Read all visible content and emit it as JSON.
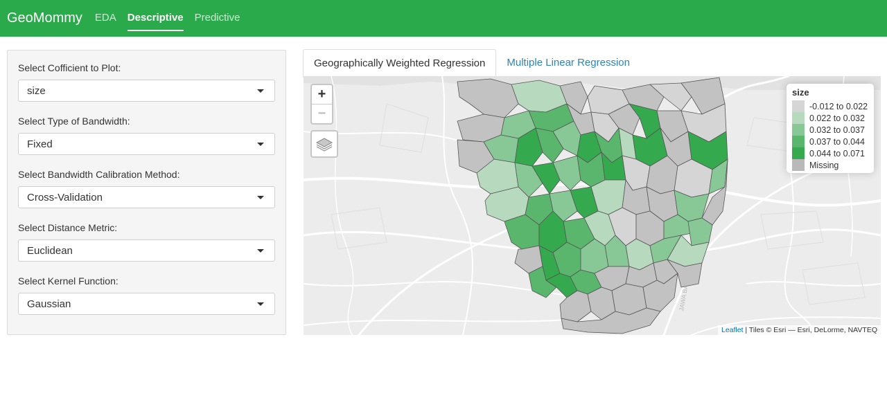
{
  "navbar": {
    "brand": "GeoMommy",
    "items": [
      {
        "label": "EDA",
        "active": false
      },
      {
        "label": "Descriptive",
        "active": true
      },
      {
        "label": "Predictive",
        "active": false
      }
    ]
  },
  "sidebar": {
    "fields": [
      {
        "label": "Select Cofficient to Plot:",
        "value": "size"
      },
      {
        "label": "Select Type of Bandwidth:",
        "value": "Fixed"
      },
      {
        "label": "Select Bandwidth Calibration Method:",
        "value": "Cross-Validation"
      },
      {
        "label": "Select Distance Metric:",
        "value": "Euclidean"
      },
      {
        "label": "Select Kernel Function:",
        "value": "Gaussian"
      }
    ]
  },
  "tabs": [
    {
      "label": "Geographically Weighted Regression",
      "active": true
    },
    {
      "label": "Multiple Linear Regression",
      "active": false
    }
  ],
  "map": {
    "zoom_in": "+",
    "zoom_out": "−",
    "watermark_label": "JAWA BARAT",
    "legend": {
      "title": "size",
      "items": [
        {
          "label": "-0.012 to 0.022",
          "color": "#d5d5d5"
        },
        {
          "label": "0.022 to 0.032",
          "color": "#b7d9be"
        },
        {
          "label": "0.032 to 0.037",
          "color": "#88c896"
        },
        {
          "label": "0.037 to 0.044",
          "color": "#5ab66d"
        },
        {
          "label": "0.044 to 0.071",
          "color": "#35a94e"
        },
        {
          "label": "Missing",
          "color": "#b9b9b9"
        }
      ]
    },
    "attribution": {
      "link": "Leaflet",
      "text": " | Tiles © Esri — Esri, DeLorme, NAVTEQ"
    }
  },
  "colors": {
    "navbar": "#2aaa4a",
    "tab_link": "#2a86b7",
    "region_border": "#555555"
  }
}
